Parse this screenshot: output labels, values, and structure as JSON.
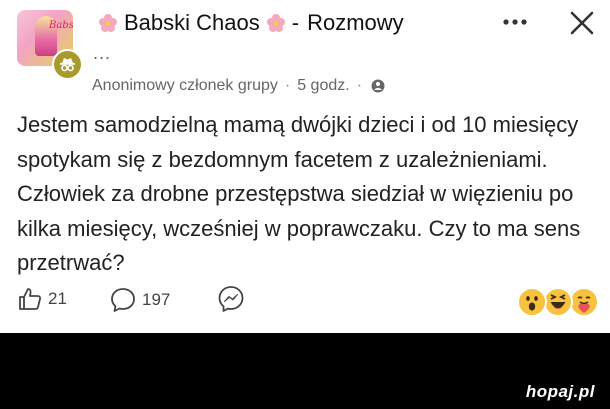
{
  "header": {
    "group_name": "Babski Chaos",
    "separator": "-",
    "section": "Rozmowy",
    "extra_dots": "..."
  },
  "post": {
    "author": "Anonimowy członek grupy",
    "time": "5 godz.",
    "dot1": "·",
    "dot2": "·",
    "text": "Jestem samodzielną mamą dwójki dzieci i od 10 miesięcy spotykam się z bezdomnym facetem z uzależnieniami. Człowiek za drobne przestępstwa siedział w więzieniu po kilka miesięcy, wcześniej w poprawczaku. Czy to ma sens przetrwać?",
    "privacy_icon": "group-icon"
  },
  "actions": {
    "likes": "21",
    "comments": "197",
    "like_icon": "thumbs-up-icon",
    "comment_icon": "comment-bubble-icon",
    "share_icon": "messenger-icon"
  },
  "reactions": [
    "wow",
    "haha",
    "care"
  ],
  "avatar_text": "Babski",
  "watermark": "hopaj.pl",
  "colors": {
    "badge": "#a99a2c",
    "flower": "#f4a9bd",
    "text": "#222222"
  }
}
